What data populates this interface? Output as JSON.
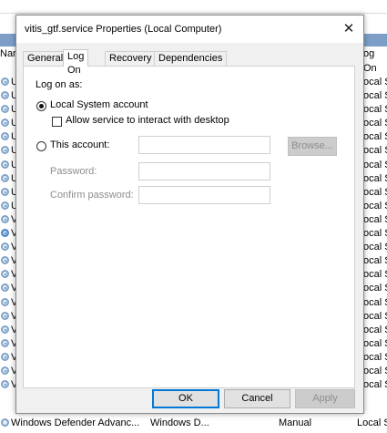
{
  "background": {
    "column_name_header": "Nar",
    "column_logon_header": "og On",
    "row_letters": [
      "U",
      "U",
      "U",
      "U",
      "U",
      "U",
      "U",
      "U",
      "U",
      "U",
      "V",
      "V",
      "V",
      "V",
      "V",
      "V",
      "V",
      "V",
      "V",
      "V",
      "V",
      "V",
      "V"
    ],
    "row_logon": [
      "ocal S",
      "ocal S",
      "ocal S",
      "ocal S",
      "ocal S",
      "ocal S",
      "ocal S",
      "ocal S",
      "ocal S",
      "ocal S",
      "ocal S",
      "ocal S",
      "ocal S",
      "ocal S",
      "ocal S",
      "ocal S",
      "ocal S",
      "ocal S",
      "ocal S",
      "ocal S",
      "ocal S",
      "ocal S",
      "ocal S"
    ],
    "bottom_row": {
      "name": "Windows Defender Advanc...",
      "description": "Windows D...",
      "startup": "Manual",
      "logon": "Local S"
    }
  },
  "dialog": {
    "title": "vitis_gtf.service Properties (Local Computer)",
    "close_glyph": "✕",
    "tabs": [
      "General",
      "Log On",
      "Recovery",
      "Dependencies"
    ],
    "active_tab": "Log On",
    "logon_as_label": "Log on as:",
    "local_system_label": "Local System account",
    "allow_interact_label": "Allow service to interact with desktop",
    "this_account_label": "This account:",
    "browse_label": "Browse...",
    "password_label": "Password:",
    "confirm_password_label": "Confirm password:",
    "account_value": "",
    "password_value": "",
    "confirm_password_value": "",
    "ok_label": "OK",
    "cancel_label": "Cancel",
    "apply_label": "Apply"
  }
}
